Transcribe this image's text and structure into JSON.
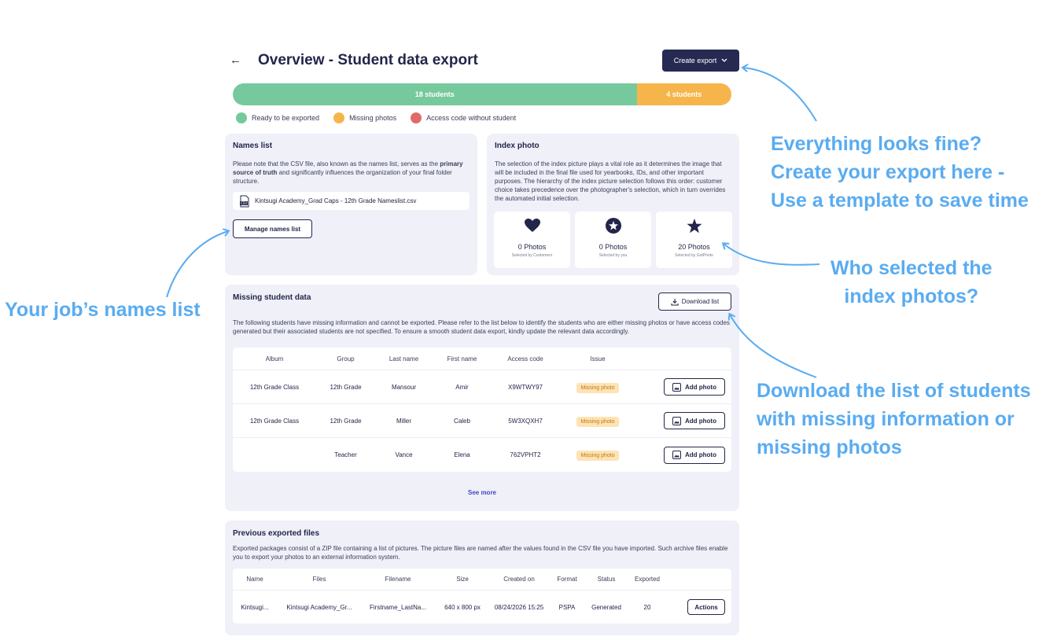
{
  "header": {
    "back_icon": "arrow-left-icon",
    "title": "Overview - Student data export",
    "create_export_label": "Create export"
  },
  "progress": {
    "ready_label": "18 students",
    "missing_label": "4 students",
    "ready_count": 18,
    "missing_count": 4,
    "colors": {
      "ready": "#76c99c",
      "missing": "#f6b54b",
      "access": "#e06a6a"
    }
  },
  "legend": {
    "ready": "Ready to be exported",
    "missing": "Missing photos",
    "access": "Access code without student"
  },
  "names_list": {
    "title": "Names list",
    "text_pre": "Please note that the CSV file, also known as the names list, serves as the",
    "text_bold": "primary source of truth",
    "text_post": "and significantly influences the organization of your final folder structure.",
    "filename": "Kintsugi Academy_Grad Caps - 12th Grade Nameslist.csv",
    "manage_label": "Manage names list"
  },
  "index_photo": {
    "title": "Index photo",
    "text": "The selection of the index picture plays a vital role as it determines the image that will be included in the final file used for yearbooks, IDs, and other important purposes. The hierarchy of the index picture selection follows this order: customer choice takes precedence over the photographer's selection, which in turn overrides the automated initial selection.",
    "stats": [
      {
        "icon": "heart-icon",
        "value": "0 Photos",
        "sub": "Selected by Customers"
      },
      {
        "icon": "star-circle-icon",
        "value": "0 Photos",
        "sub": "Selected by you"
      },
      {
        "icon": "star-icon",
        "value": "20 Photos",
        "sub": "Selected by GotPhoto"
      }
    ]
  },
  "missing": {
    "title": "Missing student data",
    "download_label": "Download list",
    "text": "The following students have missing information and cannot be exported. Please refer to the list below to identify the students who are either missing photos or have access codes generated but their associated students are not specified. To ensure a smooth student data export, kindly update the relevant data accordingly.",
    "columns": [
      "Album",
      "Group",
      "Last name",
      "First name",
      "Access code",
      "Issue"
    ],
    "rows": [
      {
        "album": "12th Grade Class",
        "group": "12th Grade",
        "last": "Mansour",
        "first": "Amir",
        "code": "X9WTWY97",
        "issue": "Missing photo",
        "action": "Add photo"
      },
      {
        "album": "12th Grade Class",
        "group": "12th Grade",
        "last": "Miller",
        "first": "Caleb",
        "code": "5W3XQXH7",
        "issue": "Missing photo",
        "action": "Add photo"
      },
      {
        "album": "",
        "group": "Teacher",
        "last": "Vance",
        "first": "Elena",
        "code": "762VPHT2",
        "issue": "Missing photo",
        "action": "Add photo"
      }
    ],
    "see_more": "See more"
  },
  "previous": {
    "title": "Previous exported files",
    "text": "Exported packages consist of a ZIP file containing a list of pictures. The picture files are named after the values found in the CSV file you have imported. Such archive files enable you to export your photos to an external information system.",
    "columns": [
      "Name",
      "Files",
      "Filename",
      "Size",
      "Created on",
      "Format",
      "Status",
      "Exported"
    ],
    "rows": [
      {
        "name": "Kintsugi...",
        "files": "Kintsugi Academy_Gr...",
        "filename": "Firstname_LastNa...",
        "size": "640 x 800 px",
        "created": "08/24/2026 15:25",
        "format": "PSPA",
        "status": "Generated",
        "exported": "20",
        "action": "Actions"
      }
    ]
  },
  "annotations": {
    "export_lines": [
      "Everything looks fine?",
      "Create your export here -",
      "Use a template to save time"
    ],
    "index_lines": [
      "Who selected the",
      "index photos?"
    ],
    "names_line": "Your job’s names list",
    "download_lines": [
      "Download the list of students",
      "with missing information or",
      "missing photos"
    ]
  }
}
